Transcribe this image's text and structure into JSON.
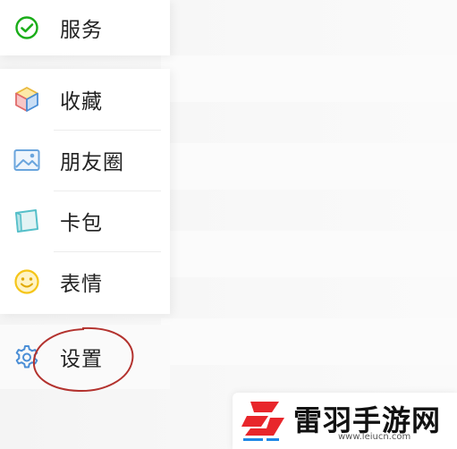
{
  "drawer": {
    "top_item": {
      "label": "服务",
      "icon": "service-icon"
    },
    "main_items": [
      {
        "label": "收藏",
        "icon": "favorites-cube-icon"
      },
      {
        "label": "朋友圈",
        "icon": "moments-image-icon"
      },
      {
        "label": "卡包",
        "icon": "card-wallet-icon"
      },
      {
        "label": "表情",
        "icon": "smiley-icon"
      }
    ],
    "settings_item": {
      "label": "设置",
      "icon": "gear-icon"
    }
  },
  "annotation": {
    "color": "#b3322e",
    "icon": "highlight-ellipse"
  },
  "watermark": {
    "title": "雷羽手游网",
    "url": "www.leiucn.com"
  },
  "colors": {
    "service_green": "#1aad19",
    "gear_blue": "#4a8ed6",
    "smiley_yellow": "#f5c518",
    "logo_red": "#e8262b",
    "logo_blue": "#1e88e5"
  }
}
